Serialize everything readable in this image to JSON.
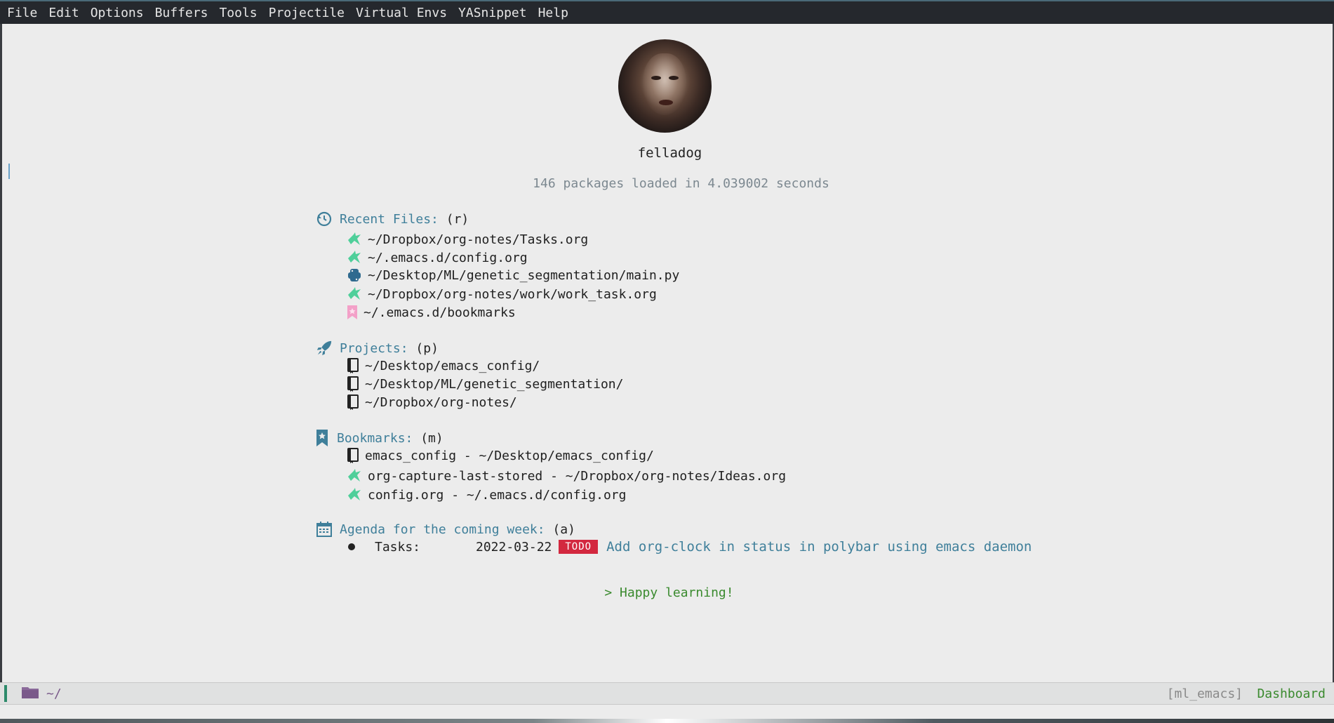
{
  "menubar": {
    "items": [
      "File",
      "Edit",
      "Options",
      "Buffers",
      "Tools",
      "Projectile",
      "Virtual Envs",
      "YASnippet",
      "Help"
    ]
  },
  "dashboard": {
    "username": "felladog",
    "load_info": "146 packages loaded in 4.039002 seconds",
    "recent_files": {
      "title": "Recent Files:",
      "key": "(r)",
      "icon": "history-icon",
      "items": [
        {
          "label": "~/Dropbox/org-notes/Tasks.org",
          "icon": "org-unicorn-icon"
        },
        {
          "label": "~/.emacs.d/config.org",
          "icon": "org-unicorn-icon"
        },
        {
          "label": "~/Desktop/ML/genetic_segmentation/main.py",
          "icon": "python-icon"
        },
        {
          "label": "~/Dropbox/org-notes/work/work_task.org",
          "icon": "org-unicorn-icon"
        },
        {
          "label": "~/.emacs.d/bookmarks",
          "icon": "bookmark-file-icon"
        }
      ]
    },
    "projects": {
      "title": "Projects:",
      "key": "(p)",
      "icon": "rocket-icon",
      "items": [
        {
          "label": "~/Desktop/emacs_config/",
          "icon": "repo-book-icon"
        },
        {
          "label": "~/Desktop/ML/genetic_segmentation/",
          "icon": "repo-book-icon"
        },
        {
          "label": "~/Dropbox/org-notes/",
          "icon": "repo-book-icon"
        }
      ]
    },
    "bookmarks": {
      "title": "Bookmarks:",
      "key": "(m)",
      "icon": "bookmark-icon",
      "items": [
        {
          "label": "emacs_config - ~/Desktop/emacs_config/",
          "icon": "repo-book-icon"
        },
        {
          "label": "org-capture-last-stored - ~/Dropbox/org-notes/Ideas.org",
          "icon": "org-unicorn-icon"
        },
        {
          "label": "config.org - ~/.emacs.d/config.org",
          "icon": "org-unicorn-icon"
        }
      ]
    },
    "agenda": {
      "title": "Agenda for the coming week:",
      "key": "(a)",
      "icon": "calendar-icon",
      "items": [
        {
          "category": "Tasks:",
          "date": "2022-03-22",
          "state": "TODO",
          "text": "Add org-clock in status in polybar using emacs daemon"
        }
      ]
    },
    "footer": "> Happy learning!"
  },
  "modeline": {
    "folder_icon": "folder-icon",
    "path": "~/",
    "venv": "[ml_emacs]",
    "mode": "Dashboard"
  },
  "colors": {
    "accent": "#3f7f9a",
    "todo": "#d3283f",
    "footer": "#3a8a2e",
    "org_icon": "#4fcf9a",
    "python_icon": "#2f6a8f",
    "bookmark_file_icon": "#f3a0c8"
  }
}
